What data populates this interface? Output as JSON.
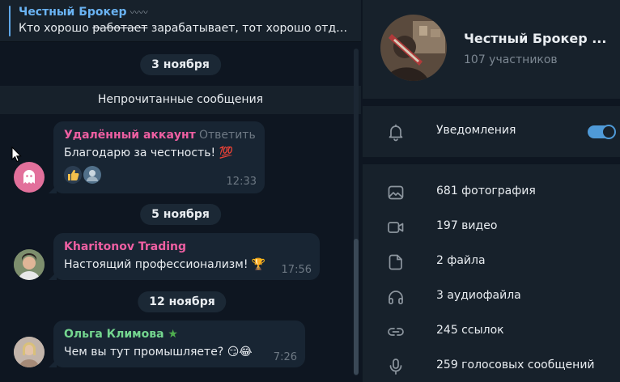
{
  "pinned": {
    "title": "Честный Брокер",
    "emoji": "〰〰",
    "text_before": "Кто хорошо ",
    "text_struck": "работает",
    "text_after": " зарабатывает, тот хорошо отдых..."
  },
  "dates": [
    "3 ноября",
    "5 ноября",
    "12 ноября"
  ],
  "unread_label": "Непрочитанные сообщения",
  "messages": [
    {
      "author": "Удалённый аккаунт",
      "author_color": "#ee5fa2",
      "reply_label": "Ответить",
      "text": "Благодарю за честность! 💯",
      "time": "12:33",
      "reactions": [
        "thumbs-up",
        "user-avatar"
      ]
    },
    {
      "author": "Kharitonov Trading",
      "author_color": "#ee5fa2",
      "text": "Настоящий профессионализм! 🏆",
      "time": "17:56"
    },
    {
      "author": "Ольга Климова",
      "author_color": "#74d68f",
      "badge": "★",
      "text": "Чем вы тут промышляете? 😏😂",
      "time": "7:26"
    }
  ],
  "channel": {
    "title": "Честный Брокер ...",
    "subtitle": "107 участников"
  },
  "notifications": {
    "label": "Уведомления",
    "enabled": true,
    "accent_color": "#4f9ad8"
  },
  "media": [
    {
      "icon": "photo-icon",
      "label": "681 фотография"
    },
    {
      "icon": "video-icon",
      "label": "197 видео"
    },
    {
      "icon": "file-icon",
      "label": "2 файла"
    },
    {
      "icon": "headphones-icon",
      "label": "3 аудиофайла"
    },
    {
      "icon": "link-icon",
      "label": "245 ссылок"
    },
    {
      "icon": "microphone-icon",
      "label": "259 голосовых сообщений"
    }
  ]
}
